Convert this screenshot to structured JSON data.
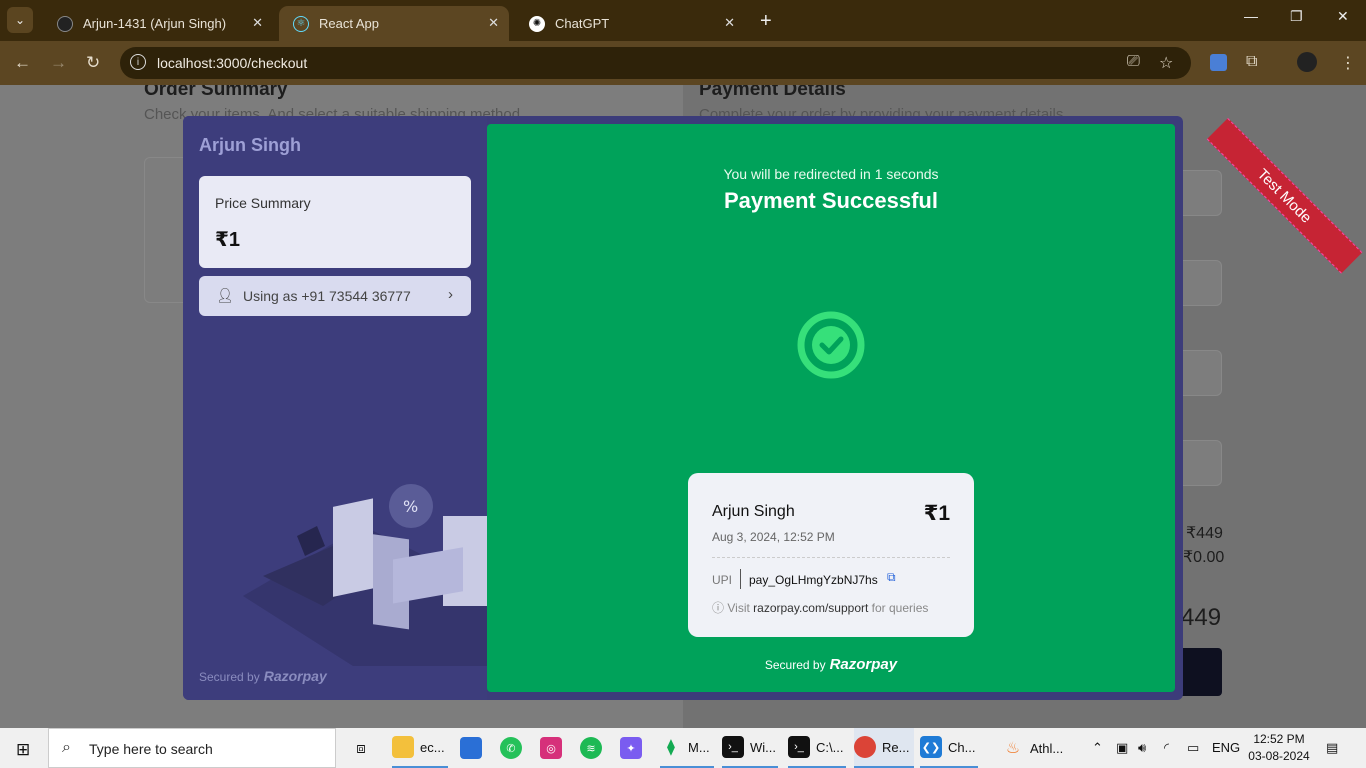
{
  "browser": {
    "tabs": [
      {
        "label": "Arjun-1431 (Arjun Singh)",
        "close": "✕"
      },
      {
        "label": "React App",
        "close": "✕"
      },
      {
        "label": "ChatGPT",
        "close": "✕"
      }
    ],
    "url": "localhost:3000/checkout"
  },
  "background_page": {
    "order_summary_title": "Order Summary",
    "order_summary_sub": "Check your items. And select a suitable shipping method.",
    "payment_title": "Payment Details",
    "payment_sub": "Complete your order by providing your payment details.",
    "subtotal": "₹449",
    "shipping": "₹0.00",
    "total": "449"
  },
  "ribbon": "Test Mode",
  "modal": {
    "merchant": "Arjun Singh",
    "price_summary_label": "Price Summary",
    "price": "₹1",
    "using_as": "Using as +91 73544 36777",
    "secured_by": "Secured by",
    "brand": "Razorpay",
    "redirect_text": "You will be redirected in 1 seconds",
    "status": "Payment Successful",
    "receipt": {
      "name": "Arjun Singh",
      "amount": "₹1",
      "date": "Aug 3, 2024, 12:52 PM",
      "method": "UPI",
      "payment_id": "pay_OgLHmgYzbNJ7hs",
      "help_prefix": "Visit",
      "help_link": "razorpay.com/support",
      "help_suffix": "for queries"
    }
  },
  "taskbar": {
    "search_placeholder": "Type here to search",
    "apps": [
      {
        "label": "ec..."
      },
      {
        "label": "M..."
      },
      {
        "label": "Wi..."
      },
      {
        "label": "C:\\..."
      },
      {
        "label": "Re..."
      },
      {
        "label": "Ch..."
      },
      {
        "label": "Athl..."
      }
    ],
    "lang": "ENG",
    "time": "12:52 PM",
    "date": "03-08-2024"
  },
  "colors": {
    "success_green": "#00a25a",
    "modal_left": "#3d3d7c",
    "test_ribbon": "#c62434"
  }
}
